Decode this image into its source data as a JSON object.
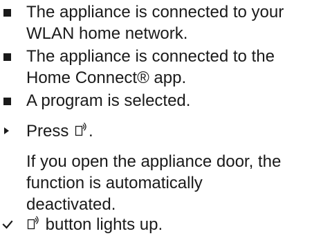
{
  "items": [
    {
      "type": "prerequisite",
      "marker": "square-bullet-icon",
      "lines": [
        "The appliance is connected to your",
        "WLAN home network."
      ]
    },
    {
      "type": "prerequisite",
      "marker": "square-bullet-icon",
      "lines": [
        "The appliance is connected to the",
        "Home Connect® app."
      ]
    },
    {
      "type": "prerequisite",
      "marker": "square-bullet-icon",
      "lines": [
        "A program is selected."
      ]
    }
  ],
  "step": {
    "marker": "triangle-step-icon",
    "before": "Press ",
    "icon": "remote-start-icon",
    "after": "."
  },
  "note": {
    "lines": [
      "If you open the appliance door, the",
      "function is automatically",
      "deactivated."
    ]
  },
  "result": {
    "marker": "check-icon",
    "icon": "remote-start-icon",
    "text": " button lights up."
  },
  "colors": {
    "text": "#1a1a1a",
    "background": "#ffffff"
  }
}
